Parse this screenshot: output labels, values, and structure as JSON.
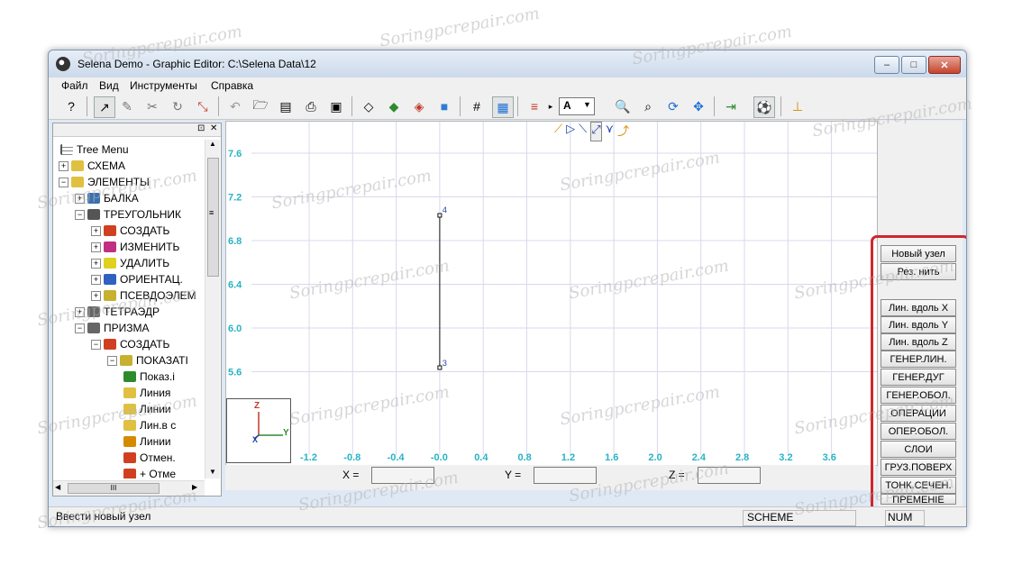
{
  "window": {
    "title": "Selena Demo - Graphic Editor:  C:\\Selena Data\\12",
    "controls": {
      "minimize": "–",
      "maximize": "□",
      "close": "✕"
    }
  },
  "menu": [
    "Файл",
    "Вид",
    "Инструменты",
    "Справка"
  ],
  "toolbar": {
    "combo_value": "A",
    "icons": [
      "help-icon",
      "select-node-icon",
      "draw-icon",
      "trim-icon",
      "rotate-icon",
      "axes-icon",
      "undo-icon",
      "open-icon",
      "save-icon",
      "print-icon",
      "view-icon",
      "cube-wire-icon",
      "cube-shade-icon",
      "cube-red-icon",
      "cube-color-icon",
      "grid-icon",
      "grid-fine-icon",
      "layers-icon",
      "zoom-in-icon",
      "zoom-window-icon",
      "refresh-icon",
      "pan-icon",
      "exit-icon",
      "ball-icon",
      "coord-icon"
    ]
  },
  "tree": {
    "root": "Tree Menu",
    "items": [
      {
        "label": "СХЕМА",
        "level": 0
      },
      {
        "label": "ЭЛЕМЕНТЫ",
        "level": 0
      },
      {
        "label": "БАЛКА",
        "level": 1
      },
      {
        "label": "ТРЕУГОЛЬНИК",
        "level": 1
      },
      {
        "label": "СОЗДАТЬ",
        "level": 2
      },
      {
        "label": "ИЗМЕНИТЬ",
        "level": 2
      },
      {
        "label": "УДАЛИТЬ",
        "level": 2
      },
      {
        "label": "ОРИЕНТАЦ.",
        "level": 2
      },
      {
        "label": "ПСЕВДОЭЛЕМ",
        "level": 2
      },
      {
        "label": "ТЕТРАЭДР",
        "level": 1
      },
      {
        "label": "ПРИЗМА",
        "level": 1
      },
      {
        "label": "СОЗДАТЬ",
        "level": 2
      },
      {
        "label": "ПОКАЗАТІ",
        "level": 3
      },
      {
        "label": "Показ.і",
        "level": 4
      },
      {
        "label": "Линия",
        "level": 4
      },
      {
        "label": "Линии",
        "level": 4
      },
      {
        "label": "Лин.в с",
        "level": 4
      },
      {
        "label": "Линии",
        "level": 4
      },
      {
        "label": "Отмен.",
        "level": 4
      },
      {
        "label": "+ Отме",
        "level": 4
      }
    ],
    "hscroll_glyph": "III",
    "vscroll_glyph": "≡"
  },
  "canvas": {
    "y_ticks": [
      "7.6",
      "7.2",
      "6.8",
      "6.4",
      "6.0",
      "5.6"
    ],
    "x_ticks": [
      "-1.2",
      "-0.8",
      "-0.4",
      "-0.0",
      "0.4",
      "0.8",
      "1.2",
      "1.6",
      "2.0",
      "2.4",
      "2.8",
      "3.2",
      "3.6"
    ],
    "node_top_label": "4",
    "node_bottom_label": "3",
    "axis_z": "Z",
    "axis_x": "X",
    "axis_y": "Y",
    "view_icons": [
      "view-xz-icon",
      "view-x-icon",
      "view-zx-icon",
      "view-y-icon",
      "view-z-icon"
    ]
  },
  "coords": {
    "x_label": "X =",
    "y_label": "Y =",
    "z_label": "Z =",
    "x_value": "",
    "y_value": "",
    "z_value": ""
  },
  "right_buttons": [
    "Новый узел",
    "Рез. нить",
    "",
    "Лин. вдоль X",
    "Лин. вдоль Y",
    "Лин. вдоль Z",
    "ГЕНЕР.ЛИН.",
    "ГЕНЕР.ДУГ",
    "ГЕНЕР.ОБОЛ.",
    "ОПЕРАЦИИ",
    "ОПЕР.ОБОЛ.",
    "СЛОИ",
    "ГРУЗ.ПОВЕРХ",
    "ТОНК.СЕЧЕН.",
    "ПРЕМЕНІЕ"
  ],
  "status": {
    "message": "Ввести новый узел",
    "mode": "SCHEME",
    "num": "NUM"
  },
  "watermark": "Soringpcrepair.com",
  "colors": {
    "axis_label": "#27b3c4",
    "highlight": "#d0262b",
    "grid": "#d8d8ec"
  }
}
